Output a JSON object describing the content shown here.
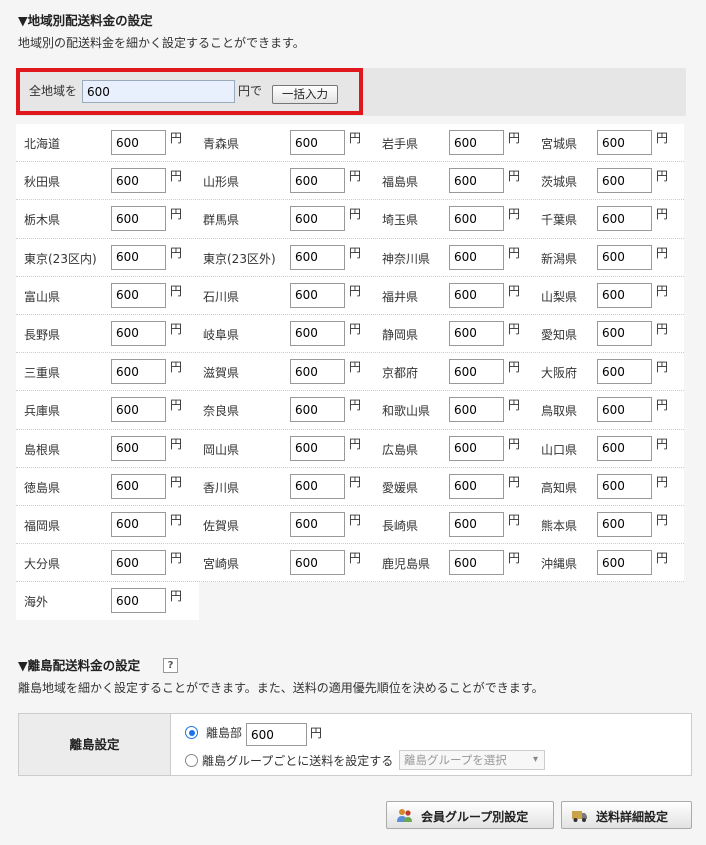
{
  "region": {
    "title": "▼地域別配送料金の設定",
    "description": "地域別の配送料金を細かく設定することができます。",
    "bulk": {
      "label": "全地域を",
      "value": "600",
      "unit": "円で",
      "button_label": "一括入力"
    },
    "yen": "円",
    "prefectures": [
      {
        "name": "北海道",
        "value": "600"
      },
      {
        "name": "青森県",
        "value": "600"
      },
      {
        "name": "岩手県",
        "value": "600"
      },
      {
        "name": "宮城県",
        "value": "600"
      },
      {
        "name": "秋田県",
        "value": "600"
      },
      {
        "name": "山形県",
        "value": "600"
      },
      {
        "name": "福島県",
        "value": "600"
      },
      {
        "name": "茨城県",
        "value": "600"
      },
      {
        "name": "栃木県",
        "value": "600"
      },
      {
        "name": "群馬県",
        "value": "600"
      },
      {
        "name": "埼玉県",
        "value": "600"
      },
      {
        "name": "千葉県",
        "value": "600"
      },
      {
        "name": "東京(23区内)",
        "value": "600"
      },
      {
        "name": "東京(23区外)",
        "value": "600"
      },
      {
        "name": "神奈川県",
        "value": "600"
      },
      {
        "name": "新潟県",
        "value": "600"
      },
      {
        "name": "富山県",
        "value": "600"
      },
      {
        "name": "石川県",
        "value": "600"
      },
      {
        "name": "福井県",
        "value": "600"
      },
      {
        "name": "山梨県",
        "value": "600"
      },
      {
        "name": "長野県",
        "value": "600"
      },
      {
        "name": "岐阜県",
        "value": "600"
      },
      {
        "name": "静岡県",
        "value": "600"
      },
      {
        "name": "愛知県",
        "value": "600"
      },
      {
        "name": "三重県",
        "value": "600"
      },
      {
        "name": "滋賀県",
        "value": "600"
      },
      {
        "name": "京都府",
        "value": "600"
      },
      {
        "name": "大阪府",
        "value": "600"
      },
      {
        "name": "兵庫県",
        "value": "600"
      },
      {
        "name": "奈良県",
        "value": "600"
      },
      {
        "name": "和歌山県",
        "value": "600"
      },
      {
        "name": "鳥取県",
        "value": "600"
      },
      {
        "name": "島根県",
        "value": "600"
      },
      {
        "name": "岡山県",
        "value": "600"
      },
      {
        "name": "広島県",
        "value": "600"
      },
      {
        "name": "山口県",
        "value": "600"
      },
      {
        "name": "徳島県",
        "value": "600"
      },
      {
        "name": "香川県",
        "value": "600"
      },
      {
        "name": "愛媛県",
        "value": "600"
      },
      {
        "name": "高知県",
        "value": "600"
      },
      {
        "name": "福岡県",
        "value": "600"
      },
      {
        "name": "佐賀県",
        "value": "600"
      },
      {
        "name": "長崎県",
        "value": "600"
      },
      {
        "name": "熊本県",
        "value": "600"
      },
      {
        "name": "大分県",
        "value": "600"
      },
      {
        "name": "宮崎県",
        "value": "600"
      },
      {
        "name": "鹿児島県",
        "value": "600"
      },
      {
        "name": "沖縄県",
        "value": "600"
      },
      {
        "name": "海外",
        "value": "600"
      }
    ]
  },
  "island": {
    "title": "▼離島配送料金の設定",
    "help_label": "?",
    "description": "離島地域を細かく設定することができます。また、送料の適用優先順位を決めることができます。",
    "header": "離島設定",
    "option1_label": "離島部",
    "option1_value": "600",
    "yen": "円",
    "option2_label": "離島グループごとに送料を設定する",
    "select_placeholder": "離島グループを選択"
  },
  "buttons": {
    "member_group": "会員グループ別設定",
    "shipping_detail": "送料詳細設定"
  }
}
